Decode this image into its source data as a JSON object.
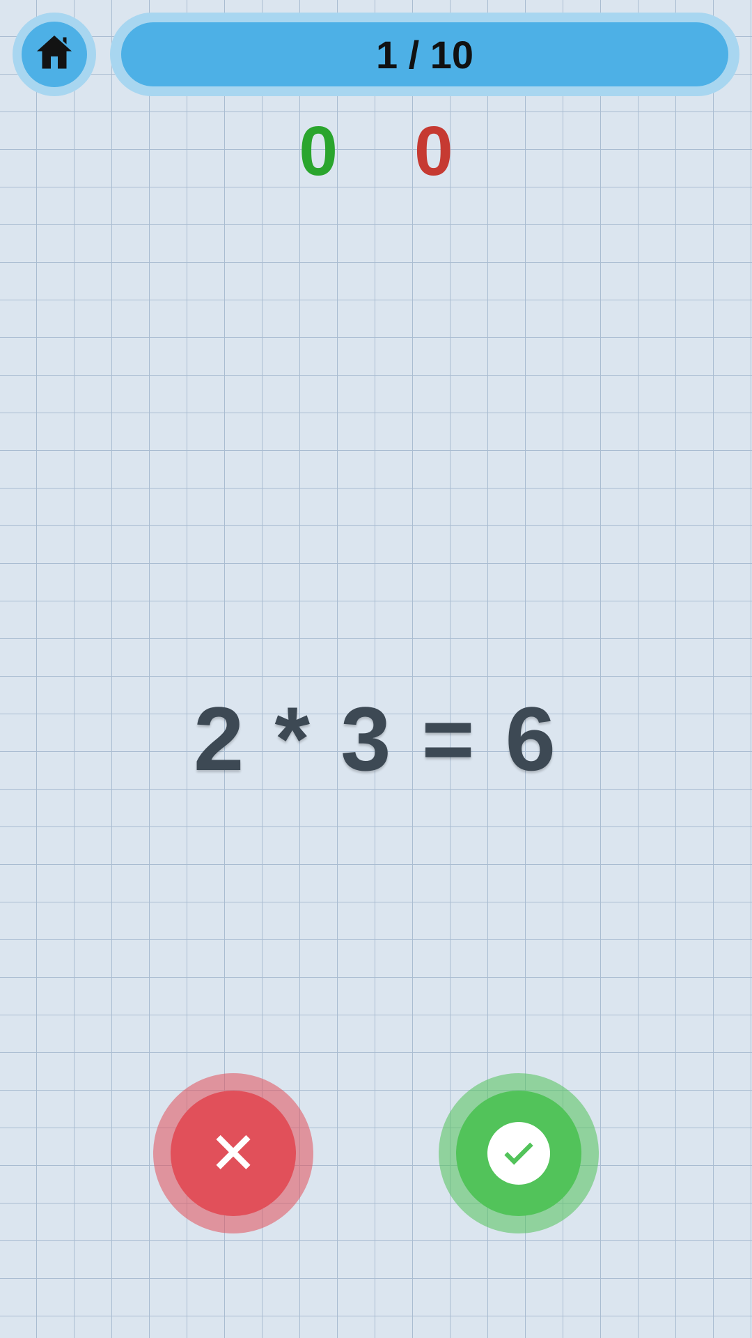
{
  "header": {
    "progress_label": "1 / 10",
    "home_icon": "home-icon"
  },
  "score": {
    "correct": "0",
    "wrong": "0"
  },
  "question": {
    "equation": "2 * 3 = 6"
  },
  "buttons": {
    "wrong_icon": "cross-icon",
    "correct_icon": "check-icon"
  },
  "colors": {
    "accent_blue": "#4db0e6",
    "accent_blue_light": "#a8d6f0",
    "correct_green": "#52c35a",
    "wrong_red": "#e1505a",
    "score_green": "#2aa52d",
    "score_red": "#c63a32"
  }
}
